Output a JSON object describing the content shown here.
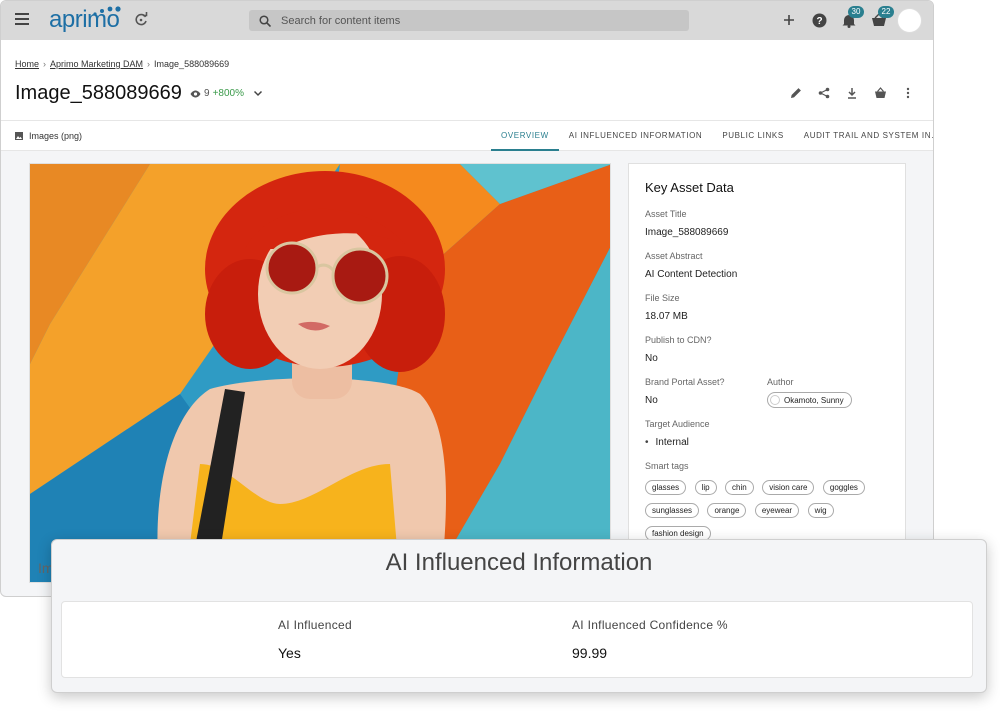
{
  "app": {
    "logo": "aprimo",
    "search_placeholder": "Search for content items",
    "notifications_count": "30",
    "basket_count": "22"
  },
  "breadcrumb": [
    "Home",
    "Aprimo Marketing DAM",
    "Image_588089669"
  ],
  "asset": {
    "title": "Image_588089669",
    "views": "9",
    "views_change": "+800%",
    "type": "Images (png)"
  },
  "tabs": [
    "OVERVIEW",
    "AI INFLUENCED INFORMATION",
    "PUBLIC LINKS",
    "AUDIT TRAIL AND SYSTEM IN…"
  ],
  "image_caption": "Im",
  "key_asset_data": {
    "heading": "Key Asset Data",
    "asset_title_label": "Asset Title",
    "asset_title": "Image_588089669",
    "asset_abstract_label": "Asset Abstract",
    "asset_abstract": "AI Content Detection",
    "file_size_label": "File Size",
    "file_size": "18.07 MB",
    "publish_cdn_label": "Publish to CDN?",
    "publish_cdn": "No",
    "brand_portal_label": "Brand Portal Asset?",
    "brand_portal": "No",
    "author_label": "Author",
    "author": "Okamoto, Sunny",
    "target_audience_label": "Target Audience",
    "target_audience": "Internal",
    "smart_tags_label": "Smart tags",
    "smart_tags": [
      "glasses",
      "lip",
      "chin",
      "vision care",
      "goggles",
      "sunglasses",
      "orange",
      "eyewear",
      "wig",
      "fashion design"
    ]
  },
  "ai_panel": {
    "title": "AI Influenced Information",
    "influenced_label": "AI Influenced",
    "influenced_value": "Yes",
    "confidence_label": "AI Influenced Confidence %",
    "confidence_value": "99.99"
  },
  "colors": {
    "accent": "#2a7f8f",
    "brand": "#1d6fa5",
    "positive": "#3a9a4a"
  }
}
